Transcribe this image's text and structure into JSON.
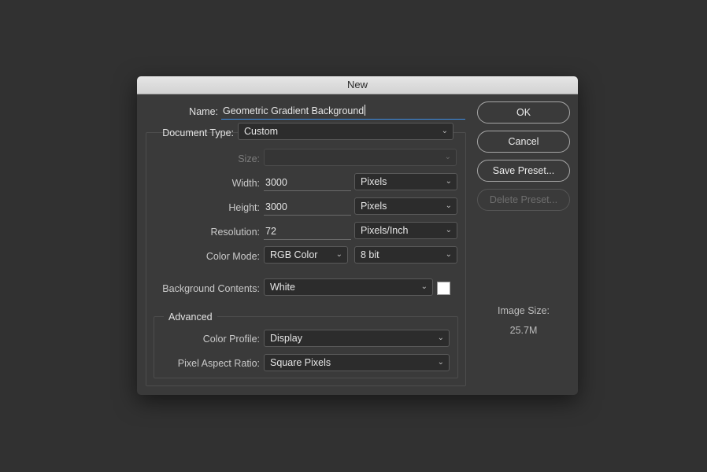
{
  "window": {
    "title": "New"
  },
  "form": {
    "name_label": "Name:",
    "name_value": "Geometric Gradient Background",
    "doc_type_label": "Document Type:",
    "doc_type_value": "Custom",
    "size_label": "Size:",
    "size_value": "",
    "width_label": "Width:",
    "width_value": "3000",
    "width_unit": "Pixels",
    "height_label": "Height:",
    "height_value": "3000",
    "height_unit": "Pixels",
    "resolution_label": "Resolution:",
    "resolution_value": "72",
    "resolution_unit": "Pixels/Inch",
    "color_mode_label": "Color Mode:",
    "color_mode_value": "RGB Color",
    "bit_depth_value": "8 bit",
    "bg_label": "Background Contents:",
    "bg_value": "White",
    "bg_swatch_color": "#ffffff"
  },
  "advanced": {
    "title": "Advanced",
    "color_profile_label": "Color Profile:",
    "color_profile_value": "Display",
    "pixel_aspect_label": "Pixel Aspect Ratio:",
    "pixel_aspect_value": "Square Pixels"
  },
  "buttons": {
    "ok": "OK",
    "cancel": "Cancel",
    "save_preset": "Save Preset...",
    "delete_preset": "Delete Preset..."
  },
  "image_size": {
    "label": "Image Size:",
    "value": "25.7M"
  },
  "icons": {
    "dropdown": "chevron-down-icon"
  },
  "colors": {
    "focus_accent": "#3d8ee6"
  }
}
